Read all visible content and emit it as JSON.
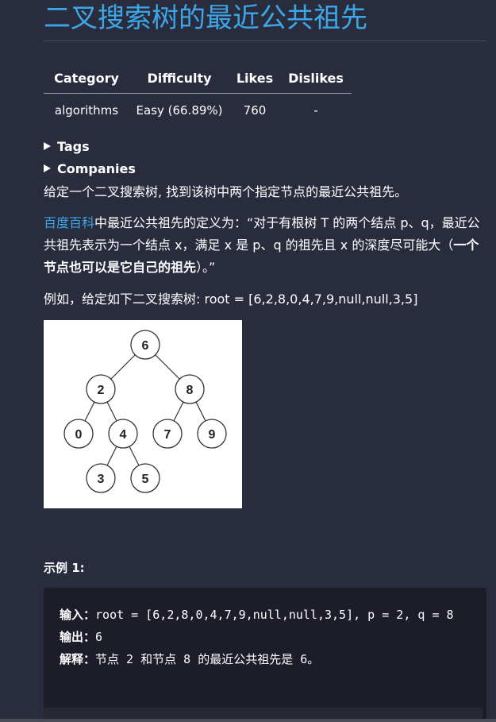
{
  "title": "二叉搜索树的最近公共祖先",
  "meta_table": {
    "headers": [
      "Category",
      "Difficulty",
      "Likes",
      "Dislikes"
    ],
    "row": [
      "algorithms",
      "Easy (66.89%)",
      "760",
      "-"
    ]
  },
  "summaries": {
    "tags": "Tags",
    "companies": "Companies"
  },
  "description": {
    "p1": "给定一个二叉搜索树, 找到该树中两个指定节点的最近公共祖先。",
    "p2_link": "百度百科",
    "p2_text": "中最近公共祖先的定义为：“对于有根树 T 的两个结点 p、q，最近公共祖先表示为一个结点 x，满足 x 是 p、q 的祖先且 x 的深度尽可能大（",
    "p2_bold": "一个节点也可以是它自己的祖先",
    "p2_end": "）。”",
    "p3": "例如，给定如下二叉搜索树:  root = [6,2,8,0,4,7,9,null,null,3,5]"
  },
  "tree": {
    "nodes": [
      "6",
      "2",
      "8",
      "0",
      "4",
      "7",
      "9",
      "3",
      "5"
    ]
  },
  "example1": {
    "heading": "示例 1:",
    "input_label": "输入：",
    "input_value": "root = [6,2,8,0,4,7,9,null,null,3,5], p = 2, q = 8",
    "output_label": "输出：",
    "output_value": "6",
    "explain_label": "解释：",
    "explain_value": "节点 2 和节点 8 的最近公共祖先是 6。"
  },
  "colors": {
    "background": "#292c3d",
    "title": "#3da6e8",
    "link": "#3da6e8",
    "code_background": "#1c1d29"
  }
}
